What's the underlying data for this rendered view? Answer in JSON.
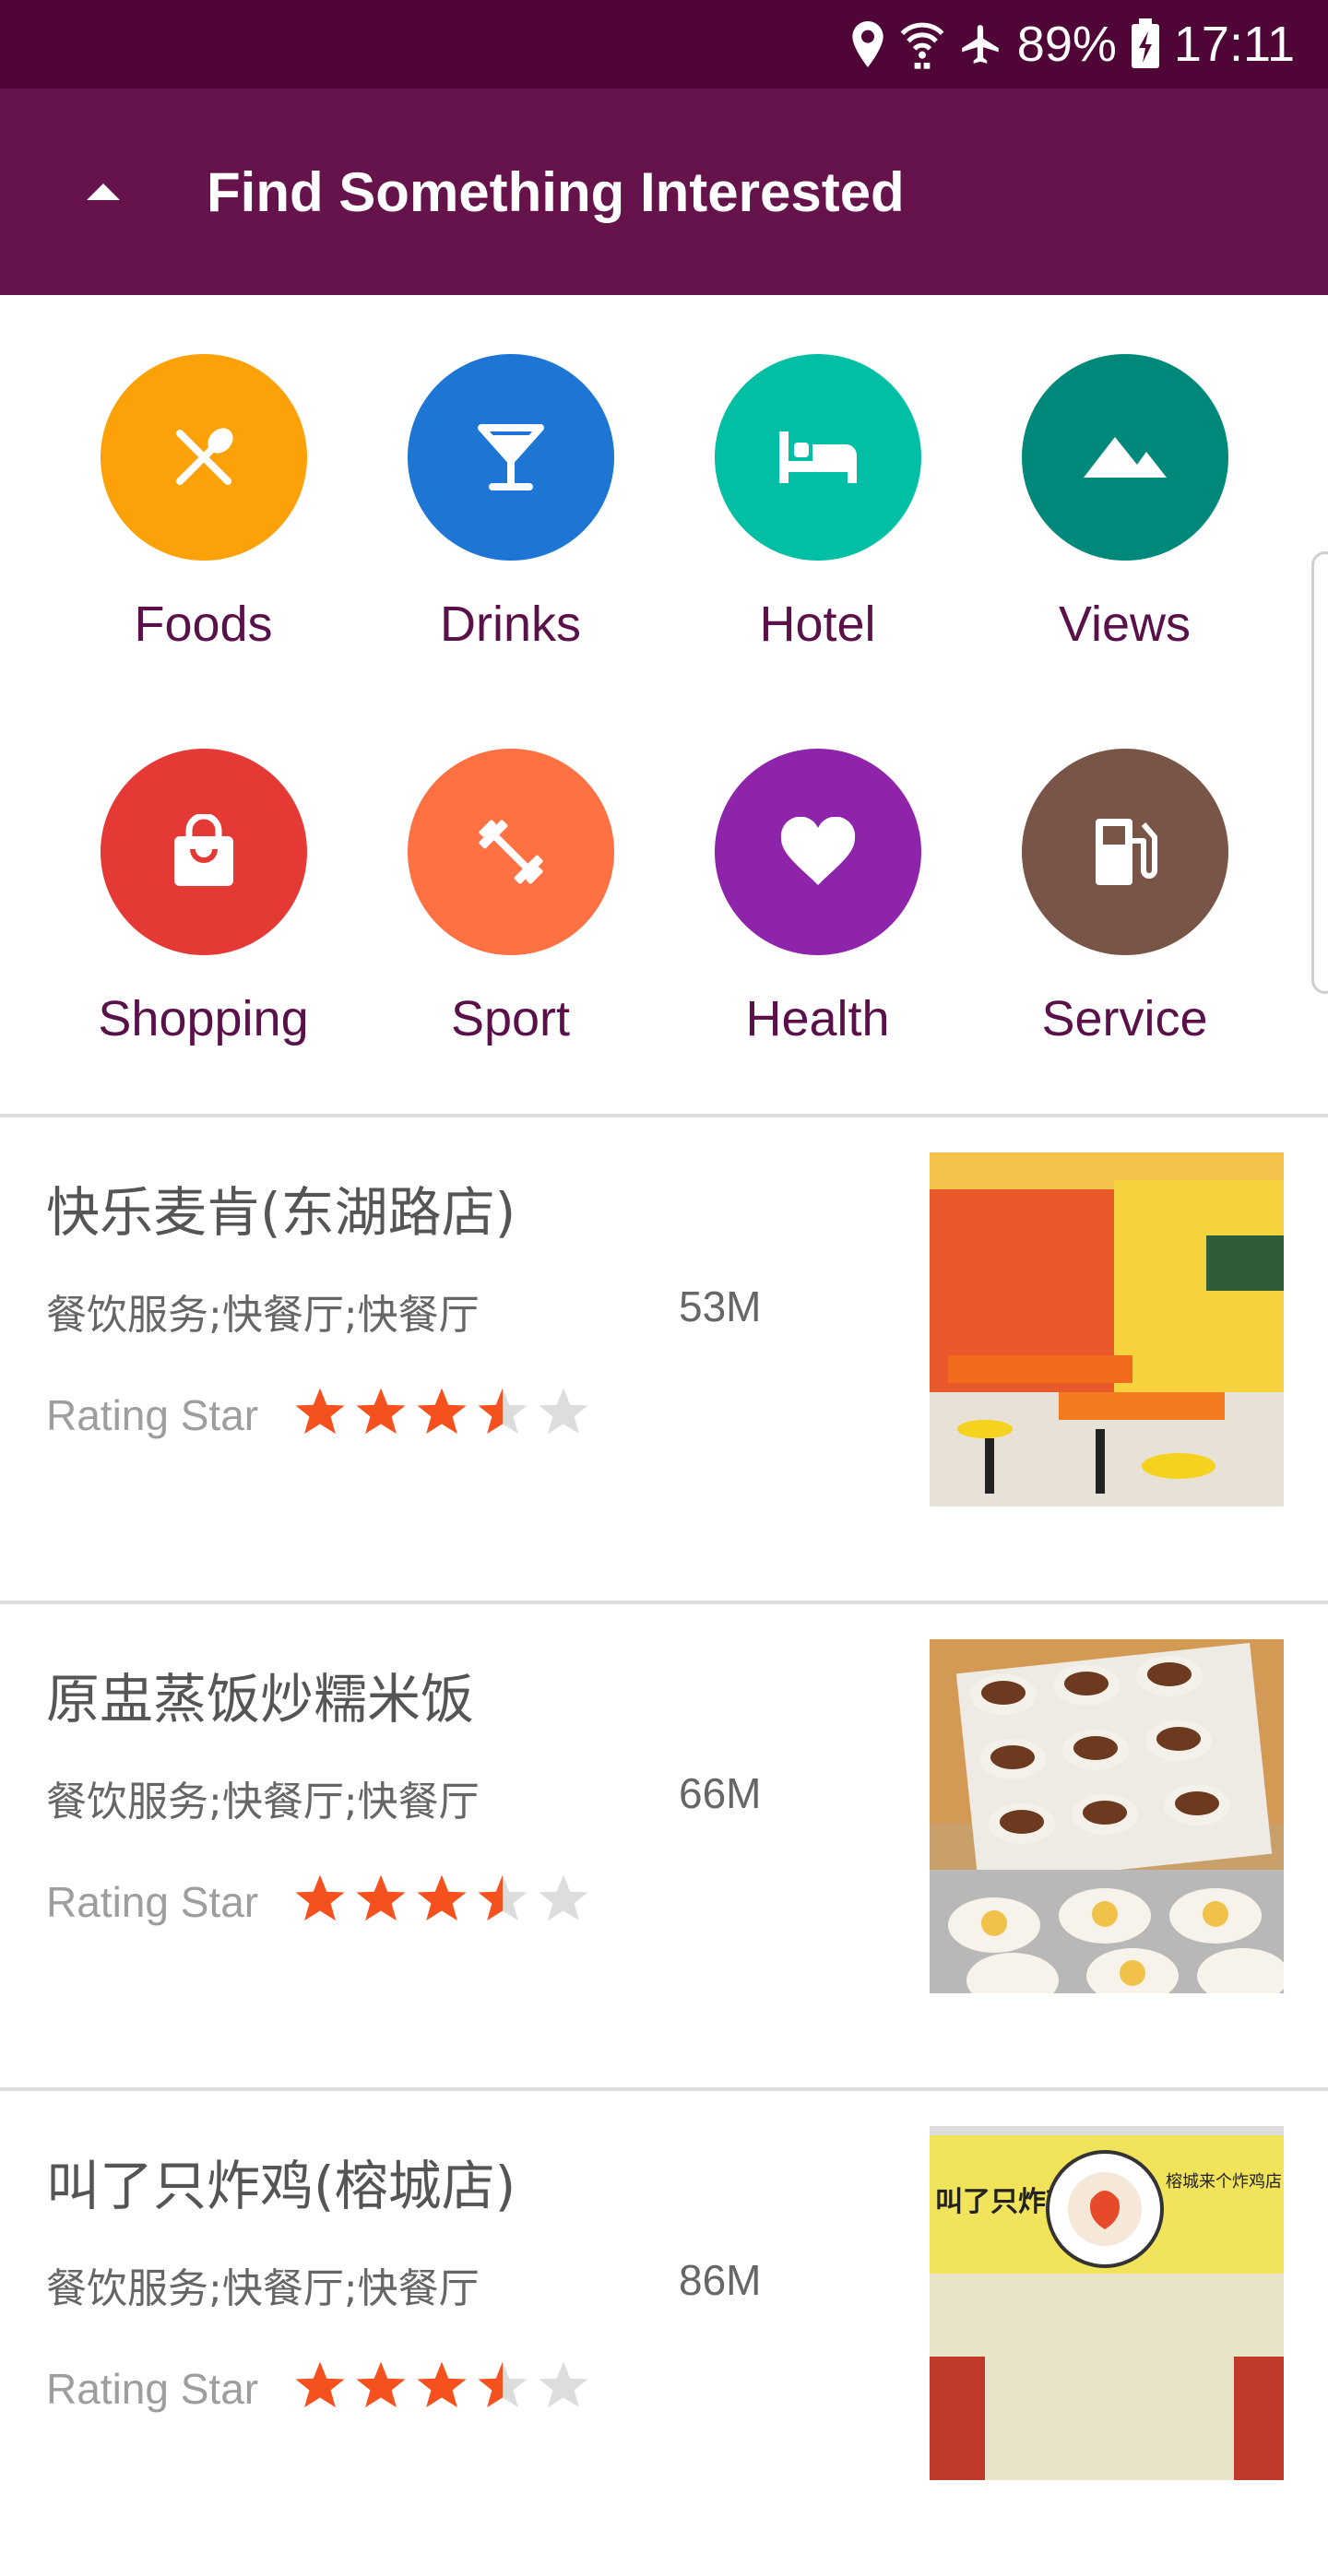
{
  "status_bar": {
    "battery": "89%",
    "time": "17:11",
    "icons": [
      "location-icon",
      "wifi-icon",
      "airplane-mode-icon",
      "battery-charging-icon"
    ]
  },
  "app_bar": {
    "title": "Find Something Interested",
    "collapse_icon": "arrow-up-icon"
  },
  "categories": [
    {
      "label": "Foods",
      "icon": "fork-spoon-icon",
      "color": "#fca107"
    },
    {
      "label": "Drinks",
      "icon": "cocktail-icon",
      "color": "#1d76d4"
    },
    {
      "label": "Hotel",
      "icon": "bed-icon",
      "color": "#00bfa5"
    },
    {
      "label": "Views",
      "icon": "mountain-icon",
      "color": "#00897b"
    },
    {
      "label": "Shopping",
      "icon": "shopping-bag-icon",
      "color": "#e53935"
    },
    {
      "label": "Sport",
      "icon": "dumbbell-icon",
      "color": "#ff7043"
    },
    {
      "label": "Health",
      "icon": "heart-icon",
      "color": "#8e24aa"
    },
    {
      "label": "Service",
      "icon": "gas-station-icon",
      "color": "#795548"
    }
  ],
  "places": [
    {
      "name": "快乐麦肯(东湖路店)",
      "category": "餐饮服务;快餐厅;快餐厅",
      "distance": "53M",
      "rating_label": "Rating Star",
      "rating": 3.5,
      "max_rating": 5
    },
    {
      "name": "原盅蒸饭炒糯米饭",
      "category": "餐饮服务;快餐厅;快餐厅",
      "distance": "66M",
      "rating_label": "Rating Star",
      "rating": 3.5,
      "max_rating": 5
    },
    {
      "name": "叫了只炸鸡(榕城店)",
      "category": "餐饮服务;快餐厅;快餐厅",
      "distance": "86M",
      "rating_label": "Rating Star",
      "rating": 3.5,
      "max_rating": 5
    }
  ],
  "thumbnail_text": {
    "shop_sign": "叫了只炸鸡",
    "shop_sign_right": "榕城来个炸鸡店"
  },
  "colors": {
    "status_bar": "#4f0637",
    "app_bar": "#65134a",
    "label": "#5a1048",
    "star_active": "#f4511e",
    "star_inactive": "#dddddd"
  }
}
